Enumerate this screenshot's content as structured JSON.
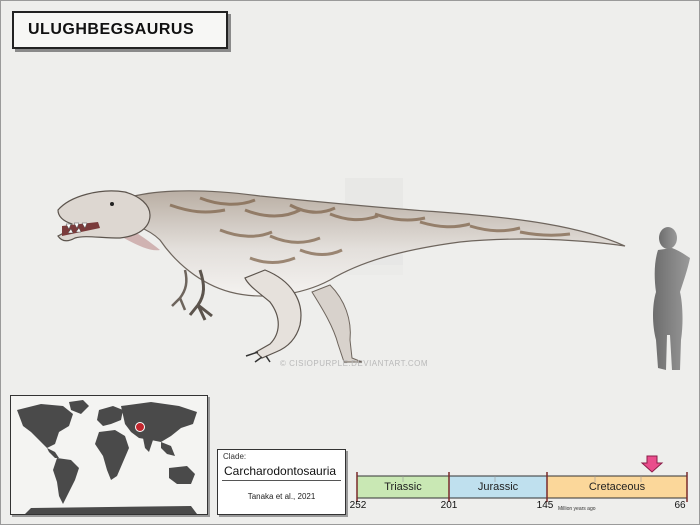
{
  "title": "ULUGHBEGSAURUS",
  "watermark": "© CISIOPURPLE.DEVIANTART.COM",
  "info": {
    "clade_label": "Clade:",
    "clade_name": "Carcharodontosauria",
    "citation": "Tanaka et al., 2021"
  },
  "timeline": {
    "periods": [
      {
        "name": "Triassic",
        "color": "#c9e8b4"
      },
      {
        "name": "Jurassic",
        "color": "#bfe0ee"
      },
      {
        "name": "Cretaceous",
        "color": "#fbd79a"
      }
    ],
    "ticks": [
      "252",
      "201",
      "145",
      "66"
    ],
    "unit_label": "Million years ago",
    "marker_color": "#e94d8c"
  },
  "map": {
    "land_color": "#4a4a4a",
    "highlight_color": "#c2262e"
  }
}
